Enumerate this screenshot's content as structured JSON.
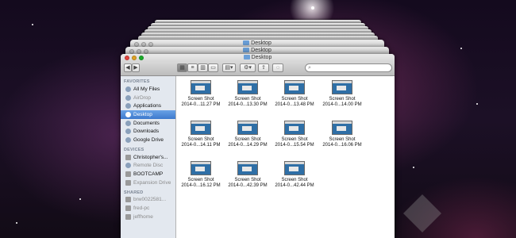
{
  "window": {
    "title": "Desktop",
    "stack_titles": [
      "Desktop",
      "Desktop"
    ]
  },
  "toolbar": {
    "back_label": "◀",
    "forward_label": "▶",
    "search_placeholder": ""
  },
  "sidebar": {
    "favorites_header": "FAVORITES",
    "favorites": [
      {
        "label": "All My Files",
        "icon": "all-files-icon"
      },
      {
        "label": "AirDrop",
        "icon": "airdrop-icon"
      },
      {
        "label": "Applications",
        "icon": "applications-icon"
      },
      {
        "label": "Desktop",
        "icon": "desktop-icon",
        "selected": true
      },
      {
        "label": "Documents",
        "icon": "documents-icon"
      },
      {
        "label": "Downloads",
        "icon": "downloads-icon"
      },
      {
        "label": "Google Drive",
        "icon": "google-drive-icon"
      }
    ],
    "devices_header": "DEVICES",
    "devices": [
      {
        "label": "Christopher's...",
        "icon": "computer-icon"
      },
      {
        "label": "Remote Disc",
        "icon": "disc-icon"
      },
      {
        "label": "BOOTCAMP",
        "icon": "drive-icon"
      },
      {
        "label": "Expansion Drive",
        "icon": "drive-icon"
      }
    ],
    "shared_header": "SHARED",
    "shared": [
      {
        "label": "brw0022581...",
        "icon": "network-icon"
      },
      {
        "label": "fred-pc",
        "icon": "network-icon"
      },
      {
        "label": "jeffhome",
        "icon": "network-icon"
      }
    ]
  },
  "files": [
    {
      "line1": "Screen Shot",
      "line2": "2014-0...11.27 PM"
    },
    {
      "line1": "Screen Shot",
      "line2": "2014-0...13.30 PM"
    },
    {
      "line1": "Screen Shot",
      "line2": "2014-0...13.48 PM"
    },
    {
      "line1": "Screen Shot",
      "line2": "2014-0...14.00 PM"
    },
    {
      "line1": "Screen Shot",
      "line2": "2014-0...14.11 PM"
    },
    {
      "line1": "Screen Shot",
      "line2": "2014-0...14.29 PM"
    },
    {
      "line1": "Screen Shot",
      "line2": "2014-0...15.54 PM"
    },
    {
      "line1": "Screen Shot",
      "line2": "2014-0...16.06 PM"
    },
    {
      "line1": "Screen Shot",
      "line2": "2014-0...16.12 PM"
    },
    {
      "line1": "Screen Shot",
      "line2": "2014-0...42.39 PM"
    },
    {
      "line1": "Screen Shot",
      "line2": "2014-0...42.44 PM"
    }
  ]
}
